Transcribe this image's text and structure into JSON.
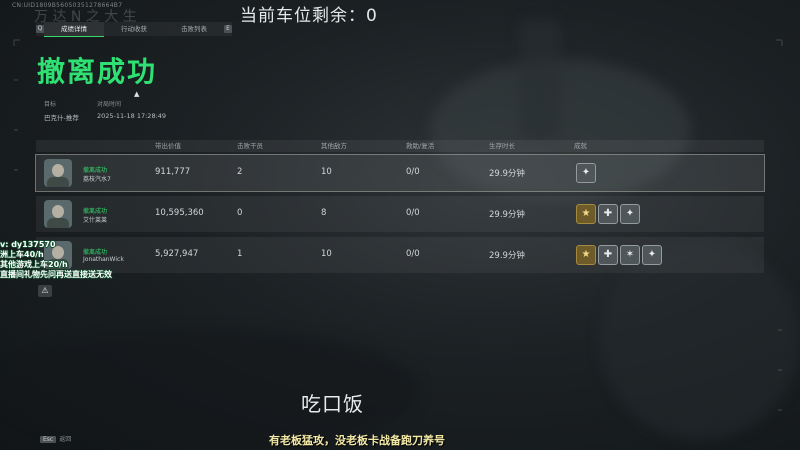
{
  "corner_id": "CN:UID1809B56050351278664B7",
  "watermark_text": "万 达 N 之 大 生",
  "top_counter": "当前车位剩余：0",
  "tabbar": {
    "left_key": "Q",
    "right_key": "E",
    "tabs": [
      "成绩详情",
      "行动收获",
      "击败列表"
    ],
    "active_index": 0
  },
  "result_title": "撤离成功",
  "meta": {
    "target_label": "目标",
    "target_value": "巴克什-推荐",
    "time_label": "对局时间",
    "time_value": "2025-11-18 17:28:49"
  },
  "table": {
    "headers": [
      "带出价值",
      "击败干员",
      "其他敌方",
      "救助/复活",
      "生存时长",
      "成就"
    ],
    "rows": [
      {
        "status": "撤离成功",
        "name": "荔枝汽水7",
        "value": "911,777",
        "kills": "2",
        "others": "10",
        "revive": "0/0",
        "survive": "29.9分钟",
        "medals": [
          "silver"
        ],
        "selected": true
      },
      {
        "status": "撤离成功",
        "name": "艾什莱莱",
        "value": "10,595,360",
        "kills": "0",
        "others": "8",
        "revive": "0/0",
        "survive": "29.9分钟",
        "medals": [
          "gold",
          "silver",
          "silver"
        ],
        "selected": false
      },
      {
        "status": "撤离成功",
        "name": "JonathanWick",
        "value": "5,927,947",
        "kills": "1",
        "others": "10",
        "revive": "0/0",
        "survive": "29.9分钟",
        "medals": [
          "gold",
          "silver",
          "silver",
          "silver"
        ],
        "selected": false
      }
    ]
  },
  "overlay": {
    "line1": "v: dy137570",
    "line2": "洲上车40/h",
    "line3": "其他游戏上车20/h",
    "line4": "直播间礼物先问再送直接送无效"
  },
  "warning_icon": "warning-icon",
  "mid_caption": "吃口饭",
  "bottom_caption": "有老板猛攻，没老板卡战备跑刀养号",
  "back_hint": {
    "key": "Esc",
    "label": "返回"
  },
  "colors": {
    "accent_green": "#2fe072",
    "gold": "#a58a3e"
  }
}
